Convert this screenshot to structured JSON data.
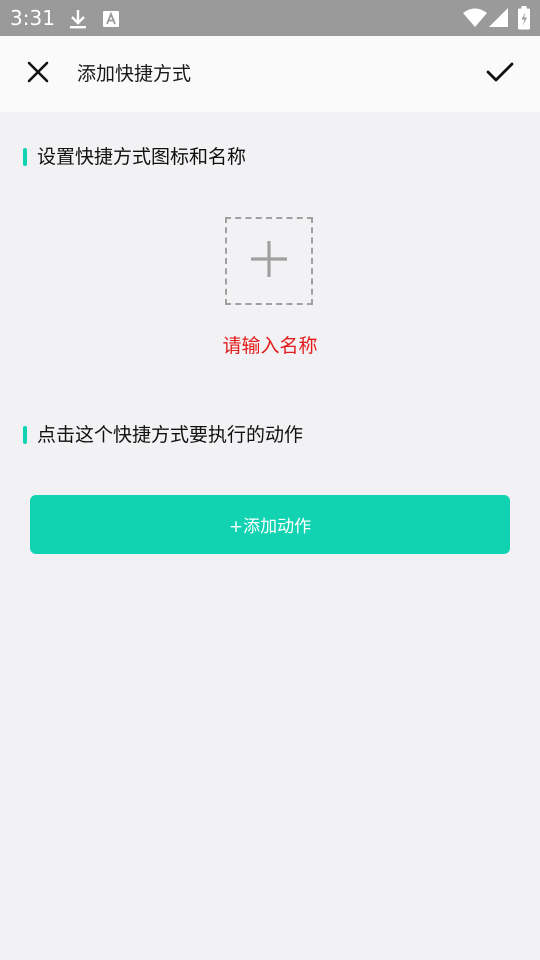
{
  "status_bar": {
    "time": "3:31",
    "icons": [
      "download-icon",
      "text-notification-icon",
      "wifi-icon",
      "signal-icon",
      "battery-charging-icon"
    ]
  },
  "header": {
    "title": "添加快捷方式",
    "close_icon": "close-icon",
    "confirm_icon": "check-icon"
  },
  "section_icon_name": {
    "title": "设置快捷方式图标和名称",
    "add_icon": "plus-icon",
    "name_placeholder": "请输入名称",
    "name_value": ""
  },
  "section_action": {
    "title": "点击这个快捷方式要执行的动作",
    "add_button_label": "+添加动作"
  },
  "colors": {
    "accent": "#12d3b1",
    "placeholder_red": "#e31b1b",
    "status_bar_bg": "#9a9a9a",
    "background": "#f2f2f4"
  }
}
